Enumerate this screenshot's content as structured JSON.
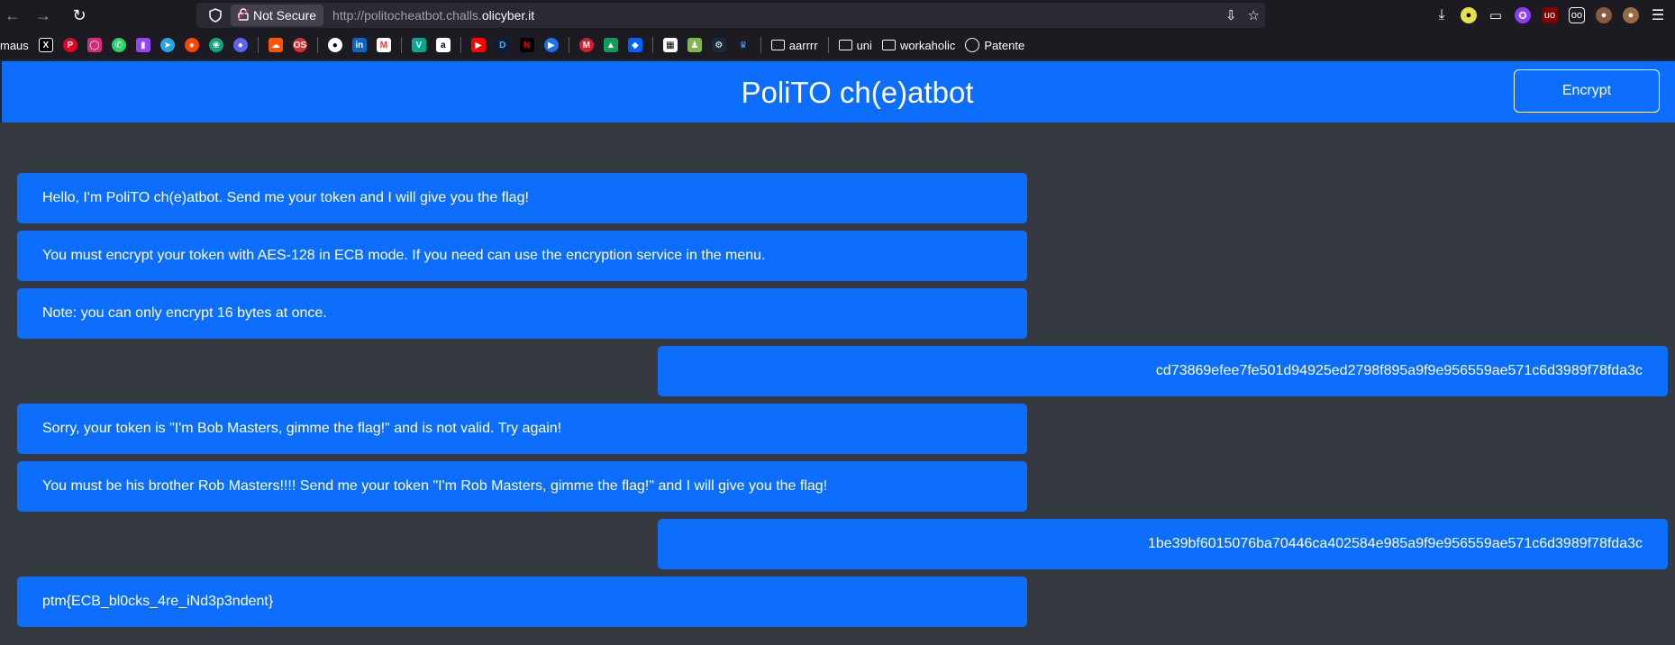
{
  "browser": {
    "security_label": "Not Secure",
    "url_prefix": "http://politocheatbot.challs.",
    "url_domain": "olicyber.it",
    "nav_icons": [
      "back-arrow-icon",
      "forward-arrow-icon",
      "reload-icon"
    ],
    "toolbar_icons": [
      "download-icon",
      "extension-icon",
      "puzzle-icon",
      "ublock-icon",
      "bookmark-star-icon",
      "menu-icon"
    ]
  },
  "bookmarks": {
    "first_label": "maus",
    "folders": [
      "aarrrr",
      "uni",
      "workaholic"
    ],
    "last_label": "Patente"
  },
  "app": {
    "title": "PoliTO ch(e)atbot",
    "encrypt_label": "Encrypt",
    "accent_color": "#0d6efd",
    "background_color": "#343a40"
  },
  "messages": [
    {
      "role": "bot",
      "text": "Hello, I'm PoliTO ch(e)atbot. Send me your token and I will give you the flag!"
    },
    {
      "role": "bot",
      "text": "You must encrypt your token with AES-128 in ECB mode. If you need can use the encryption service in the menu."
    },
    {
      "role": "bot",
      "text": "Note: you can only encrypt 16 bytes at once."
    },
    {
      "role": "user",
      "text": "cd73869efee7fe501d94925ed2798f895a9f9e956559ae571c6d3989f78fda3c"
    },
    {
      "role": "bot",
      "text": "Sorry, your token is \"I'm Bob Masters, gimme the flag!\" and is not valid. Try again!"
    },
    {
      "role": "bot",
      "text": "You must be his brother Rob Masters!!!! Send me your token \"I'm Rob Masters, gimme the flag!\" and I will give you the flag!"
    },
    {
      "role": "user",
      "text": "1be39bf6015076ba70446ca402584e985a9f9e956559ae571c6d3989f78fda3c"
    },
    {
      "role": "bot",
      "text": "ptm{ECB_bl0cks_4re_iNd3p3ndent}"
    }
  ]
}
